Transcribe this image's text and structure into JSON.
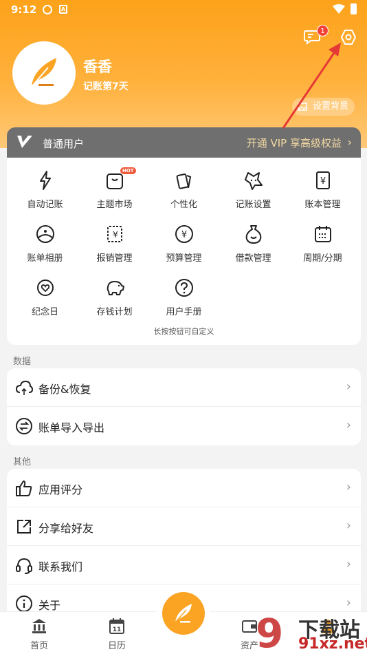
{
  "status_bar": {
    "time": "9:12",
    "ic2": "A"
  },
  "profile": {
    "name": "香香",
    "days": "记账第7天",
    "message_count": "1",
    "set_background": "设置背景"
  },
  "vip": {
    "level": "普通用户",
    "open": "开通 VIP 享高级权益"
  },
  "grid": {
    "items": [
      {
        "label": "自动记账",
        "icon": "lightning-icon"
      },
      {
        "label": "主题市场",
        "icon": "tshirt-icon",
        "hot": "HOT"
      },
      {
        "label": "个性化",
        "icon": "cards-icon"
      },
      {
        "label": "记账设置",
        "icon": "star-face-icon"
      },
      {
        "label": "账本管理",
        "icon": "ledger-icon"
      },
      {
        "label": "账单相册",
        "icon": "album-icon"
      },
      {
        "label": "报销管理",
        "icon": "reimburse-icon"
      },
      {
        "label": "预算管理",
        "icon": "yuan-circle-icon"
      },
      {
        "label": "借款管理",
        "icon": "money-bag-icon"
      },
      {
        "label": "周期/分期",
        "icon": "calendar-icon"
      },
      {
        "label": "纪念日",
        "icon": "heart-target-icon"
      },
      {
        "label": "存钱计划",
        "icon": "piggy-bank-icon"
      },
      {
        "label": "用户手册",
        "icon": "question-icon"
      }
    ],
    "hint": "长按按钮可自定义"
  },
  "sections": {
    "data": {
      "title": "数据",
      "rows": [
        "备份&恢复",
        "账单导入导出"
      ]
    },
    "other": {
      "title": "其他",
      "rows": [
        "应用评分",
        "分享给好友",
        "联系我们",
        "关于"
      ]
    }
  },
  "tabbar": {
    "tabs": [
      "首页",
      "日历",
      "资产",
      ""
    ]
  },
  "calendar_day": "11",
  "watermark": {
    "title": "下载站",
    "url": "91xz.net",
    "logo": "9"
  },
  "colors": {
    "accent": "#fba424",
    "vip_bar": "#6f6f6f",
    "vip_text": "#f3d9a3",
    "badge": "#f44336",
    "arrow": "#e53935"
  }
}
